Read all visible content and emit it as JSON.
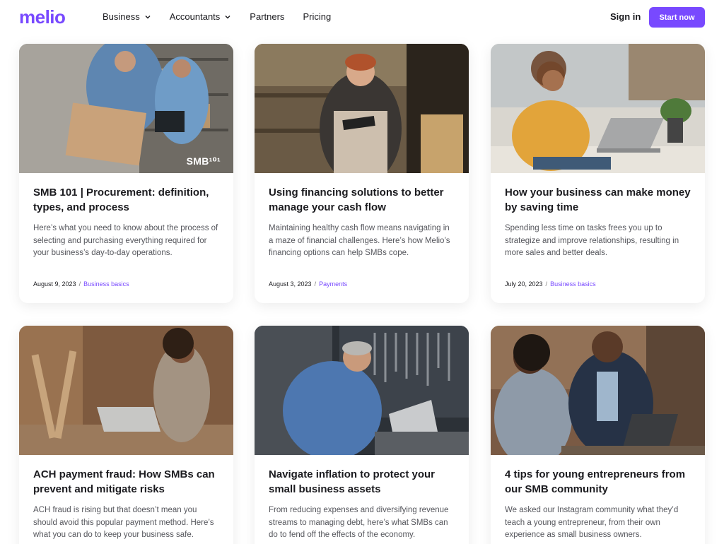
{
  "brand": {
    "name": "melio",
    "accent": "#7849ff"
  },
  "nav": [
    {
      "label": "Business",
      "has_dropdown": true
    },
    {
      "label": "Accountants",
      "has_dropdown": true
    },
    {
      "label": "Partners",
      "has_dropdown": false
    },
    {
      "label": "Pricing",
      "has_dropdown": false
    }
  ],
  "header": {
    "signin_label": "Sign in",
    "cta_label": "Start now"
  },
  "cards": [
    {
      "image_overlay": "SMB¹⁰¹",
      "title": "SMB 101 | Procurement: definition, types, and process",
      "description": "Here’s what you need to know about the process of selecting and purchasing everything required for your business’s day-to-day operations.",
      "date": "August 9, 2023",
      "category": "Business basics"
    },
    {
      "title": "Using financing solutions to better manage your cash flow",
      "description": "Maintaining healthy cash flow means navigating in a maze of financial challenges. Here’s how Melio’s financing options can help SMBs cope.",
      "date": "August 3, 2023",
      "category": "Payments"
    },
    {
      "title": "How your business can make money by saving time",
      "description": "Spending less time on tasks frees you up to strategize and improve relationships, resulting in more sales and better deals.",
      "date": "July 20, 2023",
      "category": "Business basics"
    },
    {
      "title": "ACH payment fraud: How SMBs can prevent and mitigate risks",
      "description": "ACH fraud is rising but that doesn’t mean you should avoid this popular payment method. Here’s what you can do to keep your business safe."
    },
    {
      "title": "Navigate inflation to protect your small business assets",
      "description": "From reducing expenses and diversifying revenue streams to managing debt, here’s what SMBs can do to fend off the effects of the economy."
    },
    {
      "title": "4 tips for young entrepreneurs from our SMB community",
      "description": "We asked our Instagram community what they’d teach a young entrepreneur, from their own experience as small business owners."
    }
  ]
}
